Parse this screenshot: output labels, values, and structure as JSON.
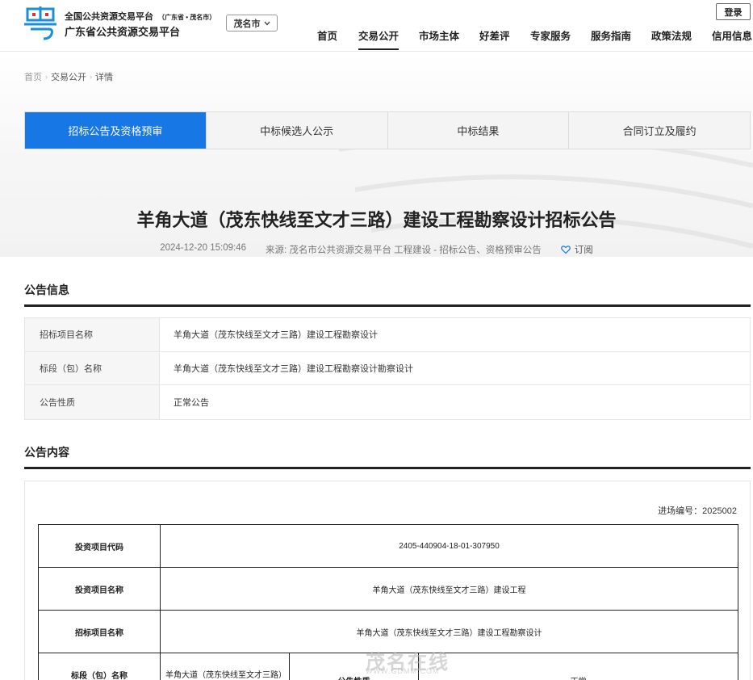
{
  "header": {
    "brand_line1": "全国公共资源交易平台",
    "brand_line1_sub": "（广东省 • 茂名市）",
    "brand_line2": "广东省公共资源交易平台",
    "city": "茂名市",
    "login": "登录",
    "nav": [
      {
        "label": "首页"
      },
      {
        "label": "交易公开"
      },
      {
        "label": "市场主体"
      },
      {
        "label": "好差评"
      },
      {
        "label": "专家服务"
      },
      {
        "label": "服务指南"
      },
      {
        "label": "政策法规"
      },
      {
        "label": "信用信息"
      }
    ]
  },
  "breadcrumb": {
    "home": "首页",
    "section": "交易公开",
    "current": "详情"
  },
  "tabs": [
    {
      "label": "招标公告及资格预审"
    },
    {
      "label": "中标候选人公示"
    },
    {
      "label": "中标结果"
    },
    {
      "label": "合同订立及履约"
    }
  ],
  "article": {
    "title": "羊角大道（茂东快线至文才三路）建设工程勘察设计招标公告",
    "datetime": "2024-12-20 15:09:46",
    "source": "来源: 茂名市公共资源交易平台 工程建设 - 招标公告、资格预审公告",
    "subscribe": "订阅"
  },
  "notice_info": {
    "heading": "公告信息",
    "rows": [
      {
        "key": "招标项目名称",
        "value": "羊角大道（茂东快线至文才三路）建设工程勘察设计"
      },
      {
        "key": "标段（包）名称",
        "value": "羊角大道（茂东快线至文才三路）建设工程勘察设计勘察设计"
      },
      {
        "key": "公告性质",
        "value": "正常公告"
      }
    ]
  },
  "notice_content": {
    "heading": "公告内容",
    "bid_number": "进场编号：2025002",
    "rows": [
      {
        "key": "投资项目代码",
        "value": "2405-440904-18-01-307950"
      },
      {
        "key": "投资项目名称",
        "value": "羊角大道（茂东快线至文才三路）建设工程"
      },
      {
        "key": "招标项目名称",
        "value": "羊角大道（茂东快线至文才三路）建设工程勘察设计"
      }
    ],
    "partial_row": {
      "key": "标段（包）名称",
      "value": "羊角大道（茂东快线至文才三路）",
      "key2": "公告性质",
      "value2": "正常"
    }
  },
  "watermark": {
    "text": "茂名在线",
    "url": "WWW.GDMM.COM"
  },
  "colors": {
    "accent": "#1677e5",
    "logo_blue": "#1a8fd8",
    "logo_red": "#e0302b"
  }
}
